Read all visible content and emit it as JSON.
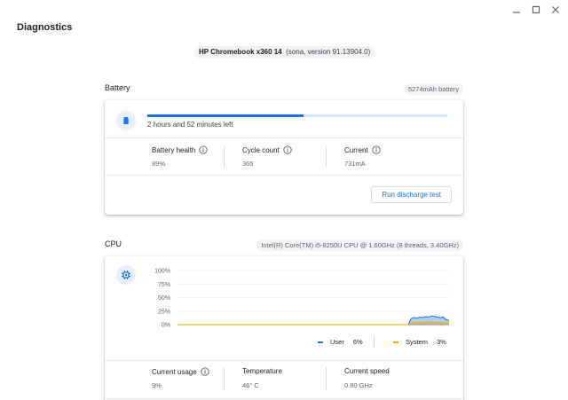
{
  "app": {
    "title": "Diagnostics"
  },
  "device": {
    "name": "HP Chromebook x360 14",
    "version": "(sona, version 91.13904.0)"
  },
  "battery": {
    "title": "Battery",
    "capacity_chip": "5274mAh battery",
    "charge_fraction": 0.52,
    "time_left": "2 hours and 52 minutes left",
    "metrics": [
      {
        "label": "Battery health",
        "value": "89%"
      },
      {
        "label": "Cycle count",
        "value": "365"
      },
      {
        "label": "Current",
        "value": "731mA"
      }
    ],
    "test_button": "Run discharge test"
  },
  "cpu": {
    "title": "CPU",
    "model_chip": "Intel(R) Core(TM) i5-8250U CPU @ 1.60GHz (8 threads, 3.40GHz)",
    "legend": {
      "user_label": "User",
      "user_value": "6%",
      "system_label": "System",
      "system_value": "3%"
    },
    "metrics": [
      {
        "label": "Current usage",
        "value": "9%"
      },
      {
        "label": "Temperature",
        "value": "46° C"
      },
      {
        "label": "Current speed",
        "value": "0.80 GHz"
      }
    ]
  },
  "colors": {
    "accent": "#1a73e8",
    "user_series": "#1a73e8",
    "system_series": "#f9ab00"
  },
  "chart_data": {
    "type": "area",
    "y_tick_labels": [
      "100%",
      "75%",
      "50%",
      "25%",
      "0%"
    ],
    "ylim": [
      0,
      100
    ],
    "series": [
      {
        "name": "User",
        "values": [
          0,
          0,
          0,
          0,
          0,
          0,
          0,
          0,
          0,
          0,
          0,
          0,
          0,
          0,
          0,
          0,
          0,
          0,
          0,
          0,
          0,
          0,
          0,
          0,
          0,
          0,
          0,
          0,
          0,
          0,
          0,
          0,
          0,
          0,
          0,
          0,
          0,
          0,
          0,
          0,
          0,
          0,
          0,
          0,
          0,
          0,
          0,
          0,
          0,
          0,
          0,
          0,
          0,
          0,
          0,
          0,
          0,
          0,
          0,
          0,
          0,
          0,
          0,
          0,
          0,
          0,
          0,
          0,
          0,
          0,
          0,
          0,
          0,
          0,
          0,
          0,
          0,
          0,
          0,
          0,
          11,
          13,
          12,
          14,
          13,
          15,
          14,
          16,
          15,
          14,
          13,
          14,
          9,
          8
        ]
      },
      {
        "name": "System",
        "values": [
          0,
          0,
          0,
          0,
          0,
          0,
          0,
          0,
          0,
          0,
          0,
          0,
          0,
          0,
          0,
          0,
          0,
          0,
          0,
          0,
          0,
          0,
          0,
          0,
          0,
          0,
          0,
          0,
          0,
          0,
          0,
          0,
          0,
          0,
          0,
          0,
          0,
          0,
          0,
          0,
          0,
          0,
          0,
          0,
          0,
          0,
          0,
          0,
          0,
          0,
          0,
          0,
          0,
          0,
          0,
          0,
          0,
          0,
          0,
          0,
          0,
          0,
          0,
          0,
          0,
          0,
          0,
          0,
          0,
          0,
          0,
          0,
          0,
          0,
          0,
          0,
          0,
          0,
          0,
          0,
          3,
          4,
          4,
          5,
          4,
          5,
          5,
          5,
          4,
          4,
          4,
          4,
          3,
          3
        ]
      }
    ]
  }
}
